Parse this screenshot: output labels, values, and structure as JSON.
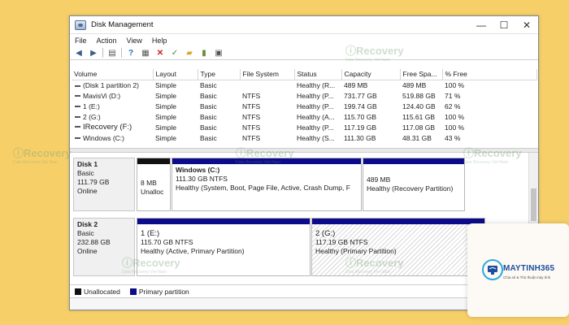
{
  "window": {
    "title": "Disk Management"
  },
  "controls": {
    "minimize": "—",
    "maximize": "☐",
    "close": "✕"
  },
  "menu": [
    "File",
    "Action",
    "View",
    "Help"
  ],
  "table": {
    "columns": [
      "Volume",
      "Layout",
      "Type",
      "File System",
      "Status",
      "Capacity",
      "Free Spa...",
      "% Free"
    ],
    "rows": [
      [
        "(Disk 1 partition 2)",
        "Simple",
        "Basic",
        "",
        "Healthy (R...",
        "489 MB",
        "489 MB",
        "100 %"
      ],
      [
        "MavisVi (D:)",
        "Simple",
        "Basic",
        "NTFS",
        "Healthy (P...",
        "731.77 GB",
        "519.88 GB",
        "71 %"
      ],
      [
        "1 (E:)",
        "Simple",
        "Basic",
        "NTFS",
        "Healthy (P...",
        "199.74 GB",
        "124.40 GB",
        "62 %"
      ],
      [
        "2 (G:)",
        "Simple",
        "Basic",
        "NTFS",
        "Healthy (A...",
        "115.70 GB",
        "115.61 GB",
        "100 %"
      ],
      [
        "IRecovery (F:)",
        "Simple",
        "Basic",
        "NTFS",
        "Healthy (P...",
        "117.19 GB",
        "117.08 GB",
        "100 %"
      ],
      [
        "Windows (C:)",
        "Simple",
        "Basic",
        "NTFS",
        "Healthy (S...",
        "111.30 GB",
        "48.31 GB",
        "43 %"
      ]
    ]
  },
  "disk1": {
    "name": "Disk 1",
    "type": "Basic",
    "size": "111.79 GB",
    "status": "Online",
    "p1": {
      "size": "8 MB",
      "label": "Unalloc"
    },
    "p2": {
      "name": "Windows (C:)",
      "size": "111.30 GB NTFS",
      "status": "Healthy (System, Boot, Page File, Active, Crash Dump, F"
    },
    "p3": {
      "size": "489 MB",
      "status": "Healthy (Recovery Partition)"
    }
  },
  "disk2": {
    "name": "Disk 2",
    "type": "Basic",
    "size": "232.88 GB",
    "status": "Online",
    "p1": {
      "name": "1 (E:)",
      "size": "115.70 GB NTFS",
      "status": "Healthy (Active, Primary Partition)"
    },
    "p2": {
      "name": "2 (G:)",
      "size": "117.19 GB NTFS",
      "status": "Healthy (Primary Partition)"
    }
  },
  "legend": {
    "unallocated": "Unallocated",
    "primary": "Primary partition"
  },
  "colors": {
    "unallocated": "#111111",
    "primary": "#0c0c8a"
  },
  "watermark": {
    "brand": "Recovery",
    "tagline": "Data Recovery Viet Nam"
  },
  "logo": {
    "brand": "MAYTINH365",
    "tagline": "Chia sẻ & Thủ thuật máy tính"
  },
  "icons": [
    "back-arrow-icon",
    "forward-arrow-icon",
    "list-view-icon",
    "help-icon",
    "properties-icon",
    "delete-icon",
    "check-icon",
    "folder-icon",
    "disk-icon",
    "view-icon"
  ]
}
